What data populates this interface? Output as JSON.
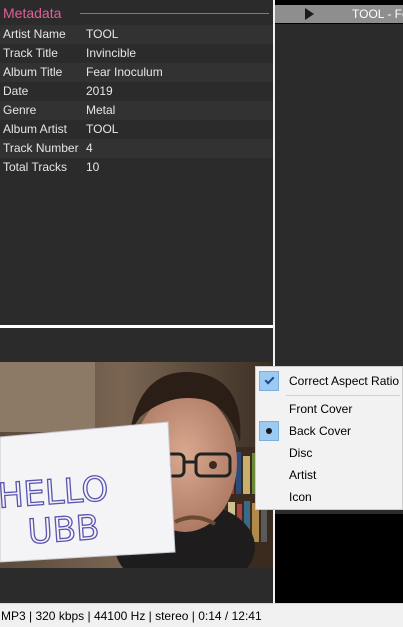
{
  "metadata_panel": {
    "title": "Metadata",
    "accent_color": "#e0609a",
    "fields": [
      {
        "key": "Artist Name",
        "value": "TOOL"
      },
      {
        "key": "Track Title",
        "value": "Invincible"
      },
      {
        "key": "Album Title",
        "value": "Fear Inoculum"
      },
      {
        "key": "Date",
        "value": "2019"
      },
      {
        "key": "Genre",
        "value": "Metal"
      },
      {
        "key": "Album Artist",
        "value": "TOOL"
      },
      {
        "key": "Track Number",
        "value": "4"
      },
      {
        "key": "Total Tracks",
        "value": "10"
      }
    ]
  },
  "playlist": {
    "current_item": "TOOL - Fe",
    "icon": "play-icon"
  },
  "album_art": {
    "photo_sign_text": "HELLO UBB"
  },
  "context_menu": {
    "correct_aspect_ratio": {
      "label": "Correct Aspect Ratio",
      "checked": true
    },
    "items": [
      {
        "label": "Front Cover",
        "selected": false
      },
      {
        "label": "Back Cover",
        "selected": true
      },
      {
        "label": "Disc",
        "selected": false
      },
      {
        "label": "Artist",
        "selected": false
      },
      {
        "label": "Icon",
        "selected": false
      }
    ]
  },
  "status_bar": {
    "text": "MP3 | 320 kbps | 44100 Hz | stereo | 0:14 / 12:41"
  }
}
